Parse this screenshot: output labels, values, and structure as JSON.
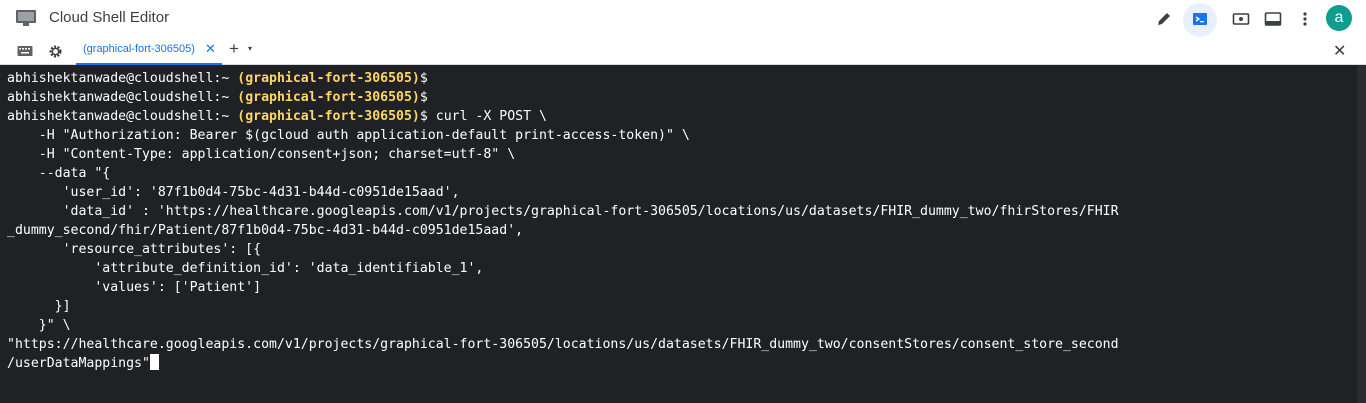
{
  "app": {
    "title": "Cloud Shell Editor"
  },
  "toolbar": {
    "icons": [
      "pencil-icon",
      "terminal-icon",
      "preview-icon",
      "maximize-icon",
      "more-vert-icon"
    ]
  },
  "user": {
    "avatar_letter": "a"
  },
  "tabs": [
    {
      "label": "(graphical-fort-306505)",
      "close": "✕",
      "active": true
    }
  ],
  "tabbar": {
    "add_symbol": "+",
    "add_caret": "▾",
    "close_symbol": "✕"
  },
  "terminal": {
    "lines": [
      {
        "prompt": "abhishektanwade@cloudshell:~ ",
        "project": "(graphical-fort-306505)",
        "tail": "$"
      },
      {
        "prompt": "abhishektanwade@cloudshell:~ ",
        "project": "(graphical-fort-306505)",
        "tail": "$"
      },
      {
        "prompt": "abhishektanwade@cloudshell:~ ",
        "project": "(graphical-fort-306505)",
        "tail": "$ curl -X POST \\"
      },
      {
        "text": "    -H \"Authorization: Bearer $(gcloud auth application-default print-access-token)\" \\"
      },
      {
        "text": "    -H \"Content-Type: application/consent+json; charset=utf-8\" \\"
      },
      {
        "text": "    --data \"{"
      },
      {
        "text": "       'user_id': '87f1b0d4-75bc-4d31-b44d-c0951de15aad',"
      },
      {
        "text": "       'data_id' : 'https://healthcare.googleapis.com/v1/projects/graphical-fort-306505/locations/us/datasets/FHIR_dummy_two/fhirStores/FHIR"
      },
      {
        "text": "_dummy_second/fhir/Patient/87f1b0d4-75bc-4d31-b44d-c0951de15aad',"
      },
      {
        "text": "       'resource_attributes': [{"
      },
      {
        "text": "           'attribute_definition_id': 'data_identifiable_1',"
      },
      {
        "text": "           'values': ['Patient']"
      },
      {
        "text": "      }]"
      },
      {
        "text": "    }\" \\"
      },
      {
        "text": "\"https://healthcare.googleapis.com/v1/projects/graphical-fort-306505/locations/us/datasets/FHIR_dummy_two/consentStores/consent_store_second"
      },
      {
        "text": "/userDataMappings\"",
        "cursor": true
      }
    ]
  },
  "colors": {
    "terminal_bg": "#202124",
    "project_highlight": "#fdd663",
    "accent": "#1a73e8"
  }
}
